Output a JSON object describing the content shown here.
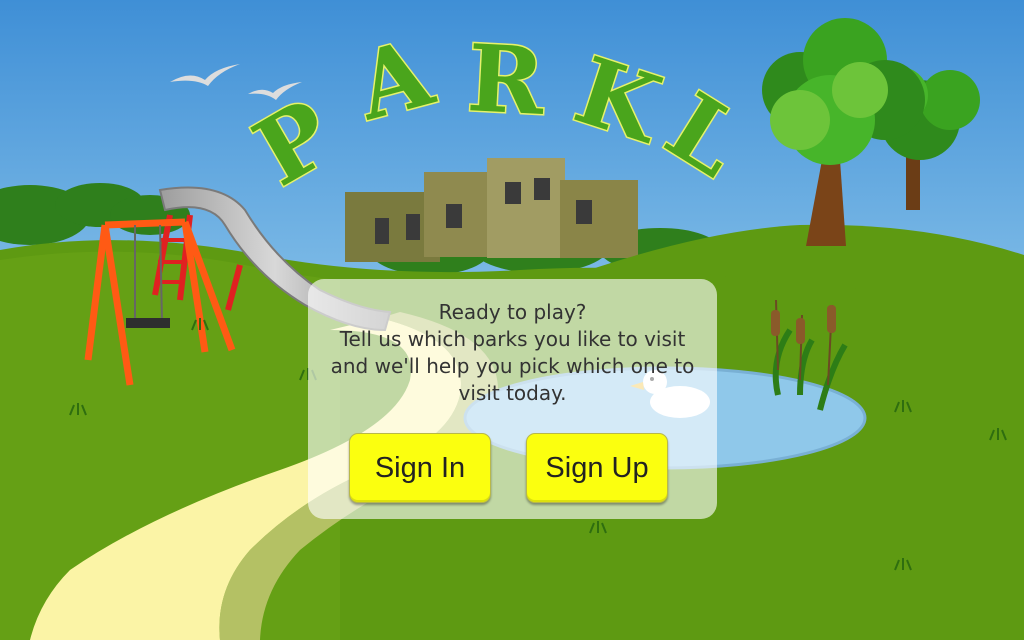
{
  "app": {
    "title_letters": [
      "P",
      "A",
      "R",
      "K",
      "L"
    ]
  },
  "welcome": {
    "lines": [
      "Ready to play?",
      "Tell us which parks you like to visit",
      "and we'll help you pick which one to",
      "visit today."
    ],
    "sign_in_label": "Sign In",
    "sign_up_label": "Sign Up"
  },
  "colors": {
    "sky_top": "#3f8fd6",
    "sky_bottom": "#c9f0fb",
    "grass": "#5e9a12",
    "grass_light": "#79b626",
    "path": "#fbf4a6",
    "title_green": "#4aa51c",
    "button_yellow": "#fbff0f",
    "pond": "#8fc8ea",
    "swing_orange": "#ff5a14"
  }
}
